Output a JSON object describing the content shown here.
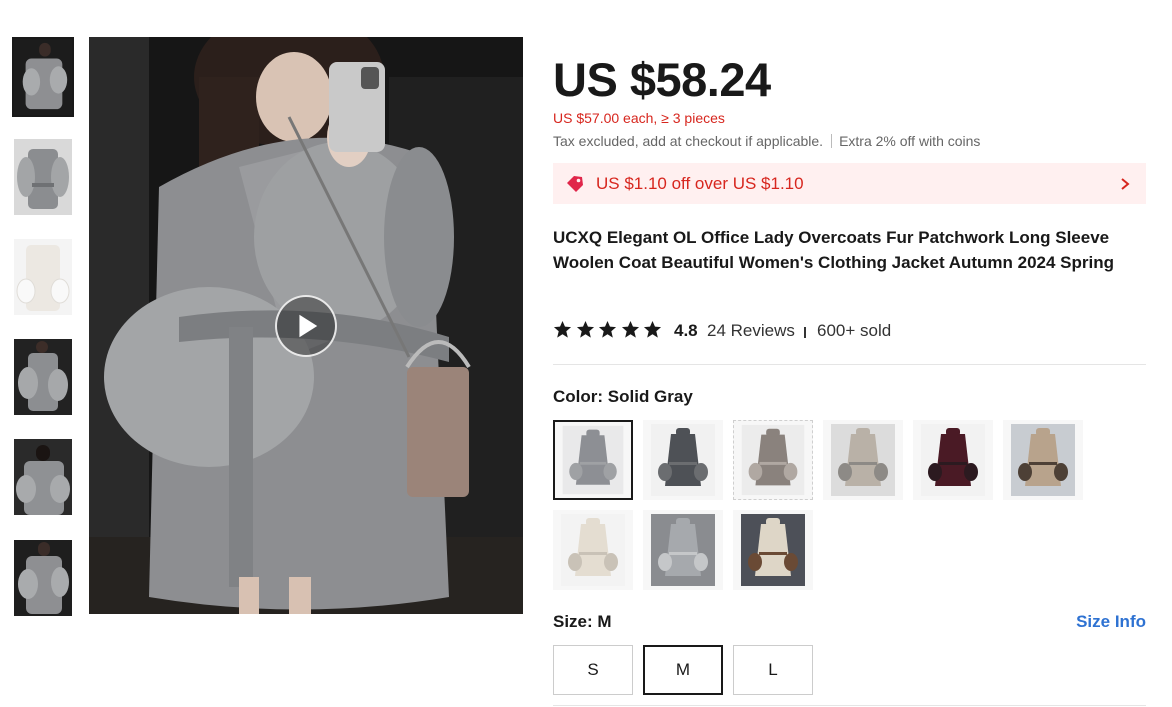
{
  "gallery": {
    "thumbnails": [
      {
        "name": "thumb-1",
        "active": true
      },
      {
        "name": "thumb-2",
        "active": false
      },
      {
        "name": "thumb-3",
        "active": false
      },
      {
        "name": "thumb-4",
        "active": false
      },
      {
        "name": "thumb-5",
        "active": false
      },
      {
        "name": "thumb-6",
        "active": false
      }
    ],
    "play_icon": "play-icon"
  },
  "product": {
    "price": "US $58.24",
    "bulk_price": "US $57.00 each, ≥ 3 pieces",
    "tax_note": "Tax excluded, add at checkout if applicable.",
    "coins_note": "Extra 2% off with coins",
    "coupon_text": "US $1.10 off over US $1.10",
    "title": "UCXQ Elegant OL Office Lady Overcoats Fur Patchwork Long Sleeve Woolen Coat Beautiful Women's Clothing Jacket Autumn 2024 Spring",
    "rating": "4.8",
    "stars_filled": 5,
    "reviews": "24 Reviews",
    "sold": "600+ sold"
  },
  "color": {
    "label": "Color:",
    "selected": "Solid Gray",
    "swatches": [
      {
        "name": "swatch-solid-gray",
        "coat": "#8d8f94",
        "fur": "#9fa1a4",
        "bg": "#e9e9ea",
        "selected": true
      },
      {
        "name": "swatch-dark-gray",
        "coat": "#4e5156",
        "fur": "#6b6d70",
        "bg": "#f1f1f1",
        "selected": false
      },
      {
        "name": "swatch-taupe",
        "coat": "#8a827d",
        "fur": "#b0a8a2",
        "bg": "#ececec",
        "selected": false,
        "dashed": true
      },
      {
        "name": "swatch-beige-gray",
        "coat": "#b9b1a7",
        "fur": "#8d8a86",
        "bg": "#dcdcdc",
        "selected": false
      },
      {
        "name": "swatch-burgundy",
        "coat": "#4a1a25",
        "fur": "#2c1a20",
        "bg": "#f2f2f2",
        "selected": false
      },
      {
        "name": "swatch-camel",
        "coat": "#b8a38c",
        "fur": "#4d4036",
        "bg": "#c8ccd1",
        "selected": false
      },
      {
        "name": "swatch-ivory",
        "coat": "#e4ddd1",
        "fur": "#c9c2b7",
        "bg": "#f3f3f3",
        "selected": false
      },
      {
        "name": "swatch-light-gray",
        "coat": "#a6a9ad",
        "fur": "#c5c7c9",
        "bg": "#8a8c90",
        "selected": false
      },
      {
        "name": "swatch-cream-brown",
        "coat": "#ded6c7",
        "fur": "#6a4a35",
        "bg": "#4d5058",
        "selected": false
      }
    ]
  },
  "size": {
    "label": "Size:",
    "selected": "M",
    "info_link": "Size Info",
    "options": [
      "S",
      "M",
      "L"
    ]
  },
  "colors": {
    "accent_red": "#d7261e",
    "link_blue": "#2e72d2",
    "coupon_bg": "#fff0f0",
    "text": "#191919"
  }
}
